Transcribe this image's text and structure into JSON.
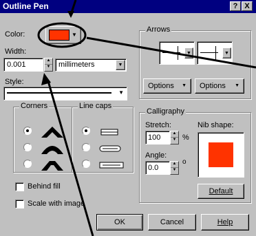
{
  "window": {
    "title": "Outline Pen",
    "help_btn": "?",
    "close_btn": "X"
  },
  "color": {
    "label": "Color:",
    "swatch": "#ff3300"
  },
  "width": {
    "label": "Width:",
    "value": "0.001",
    "unit": "millimeters"
  },
  "style": {
    "label": "Style:"
  },
  "arrows": {
    "title": "Arrows",
    "options_left": "Options",
    "options_right": "Options"
  },
  "corners": {
    "title": "Corners"
  },
  "linecaps": {
    "title": "Line caps"
  },
  "calligraphy": {
    "title": "Calligraphy",
    "stretch_label": "Stretch:",
    "stretch_value": "100",
    "stretch_unit": "%",
    "angle_label": "Angle:",
    "angle_value": "0.0",
    "angle_unit": "o",
    "nib_label": "Nib shape:",
    "nib_color": "#ff3300",
    "default_btn": "Default"
  },
  "checks": {
    "behind_fill": "Behind fill",
    "scale_with_image": "Scale with image"
  },
  "footer": {
    "ok": "OK",
    "cancel": "Cancel",
    "help": "Help"
  }
}
